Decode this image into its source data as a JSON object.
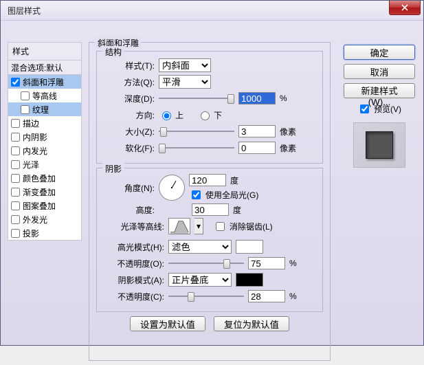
{
  "window": {
    "title": "图层样式"
  },
  "stylesHeader": "样式",
  "blendDefault": "混合选项:默认",
  "styles": {
    "bevel": "斜面和浮雕",
    "contour": "等高线",
    "texture": "纹理",
    "stroke": "描边",
    "innerShadow": "内阴影",
    "innerGlow": "内发光",
    "satin": "光泽",
    "colorOverlay": "颜色叠加",
    "gradientOverlay": "渐变叠加",
    "patternOverlay": "图案叠加",
    "outerGlow": "外发光",
    "dropShadow": "投影"
  },
  "bevel": {
    "sectionTitle": "斜面和浮雕",
    "structure": "结构",
    "styleLabel": "样式(T):",
    "styleValue": "内斜面",
    "techLabel": "方法(Q):",
    "techValue": "平滑",
    "depthLabel": "深度(D):",
    "depthValue": "1000",
    "pct": "%",
    "dirLabel": "方向:",
    "up": "上",
    "down": "下",
    "sizeLabel": "大小(Z):",
    "sizeValue": "3",
    "px": "像素",
    "softenLabel": "软化(F):",
    "softenValue": "0",
    "shadow": "阴影",
    "angleLabel": "角度(N):",
    "angleValue": "120",
    "deg": "度",
    "globalLight": "使用全局光(G)",
    "altitudeLabel": "高度:",
    "altitudeValue": "30",
    "glossLabel": "光泽等高线:",
    "antialias": "消除锯齿(L)",
    "hlModeLabel": "高光模式(H):",
    "hlModeValue": "滤色",
    "hlOpLabel": "不透明度(O):",
    "hlOpValue": "75",
    "shModeLabel": "阴影模式(A):",
    "shModeValue": "正片叠底",
    "shOpLabel": "不透明度(C):",
    "shOpValue": "28",
    "setDefault": "设置为默认值",
    "resetDefault": "复位为默认值"
  },
  "right": {
    "ok": "确定",
    "cancel": "取消",
    "newStyle": "新建样式(W)...",
    "preview": "预览(V)"
  },
  "colors": {
    "hl": "#ffffff",
    "sh": "#000000"
  }
}
